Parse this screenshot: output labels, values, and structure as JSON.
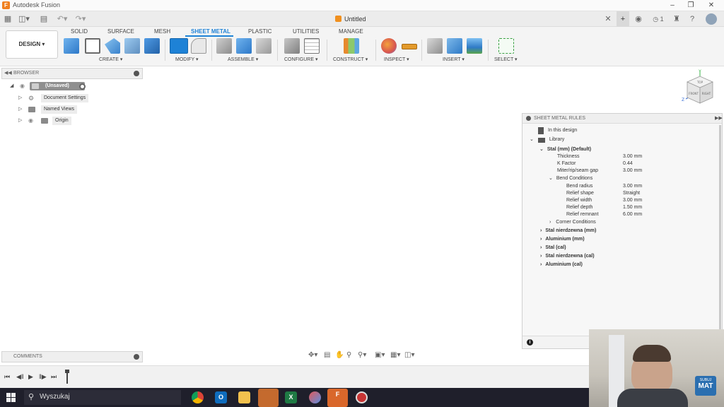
{
  "window": {
    "title": "Autodesk Fusion",
    "logo_letter": "F"
  },
  "appbar": {
    "document_title": "Untitled",
    "job_count": "1"
  },
  "ribbon": {
    "workspace_button": "DESIGN",
    "tabs": [
      "SOLID",
      "SURFACE",
      "MESH",
      "SHEET METAL",
      "PLASTIC",
      "UTILITIES",
      "MANAGE"
    ],
    "active_tab": "SHEET METAL",
    "groups": [
      "CREATE",
      "MODIFY",
      "ASSEMBLE",
      "CONFIGURE",
      "CONSTRUCT",
      "INSPECT",
      "INSERT",
      "SELECT"
    ]
  },
  "browser": {
    "title": "BROWSER",
    "root": "(Unsaved)",
    "items": [
      "Document Settings",
      "Named Views",
      "Origin"
    ]
  },
  "viewcube": {
    "top": "TOP",
    "front": "FRONT",
    "right": "RIGHT",
    "axis_y": "Y",
    "axis_z": "Z"
  },
  "sheet_metal_rules": {
    "title": "SHEET METAL RULES",
    "in_this_design": "In this design",
    "library": "Library",
    "expanded_rule": "Stal (mm) (Default)",
    "props": [
      {
        "label": "Thickness",
        "value": "3.00 mm"
      },
      {
        "label": "K Factor",
        "value": "0.44"
      },
      {
        "label": "Miter/rip/seam gap",
        "value": "3.00 mm"
      }
    ],
    "bend_conditions": "Bend Conditions",
    "bend_props": [
      {
        "label": "Bend radius",
        "value": "3.00 mm"
      },
      {
        "label": "Relief shape",
        "value": "Straight"
      },
      {
        "label": "Relief width",
        "value": "3.00 mm"
      },
      {
        "label": "Relief depth",
        "value": "1.50 mm"
      },
      {
        "label": "Relief remnant",
        "value": "6.00 mm"
      }
    ],
    "corner_conditions": "Corner Conditions",
    "other_rules": [
      "Stal nierdzewna (mm)",
      "Aluminium (mm)",
      "Stal (cal)",
      "Stal nierdzewna (cal)",
      "Aluminium (cal)"
    ],
    "info_icon": "i"
  },
  "comments": {
    "title": "COMMENTS"
  },
  "taskbar": {
    "search_text": "Wyszukaj",
    "apps": [
      "chrome",
      "outlook",
      "file-explorer",
      "screen-capture",
      "excel",
      "paint",
      "fusion",
      "recorder"
    ],
    "app_letters": {
      "outlook": "O",
      "excel": "X",
      "fusion": "F"
    }
  },
  "webcam": {
    "brand_line1": "SUBUJ",
    "brand_line2": "MAT"
  },
  "colors": {
    "accent": "#1e82d6",
    "fusion_orange": "#f0801f",
    "taskbar": "#1f1f2b"
  }
}
